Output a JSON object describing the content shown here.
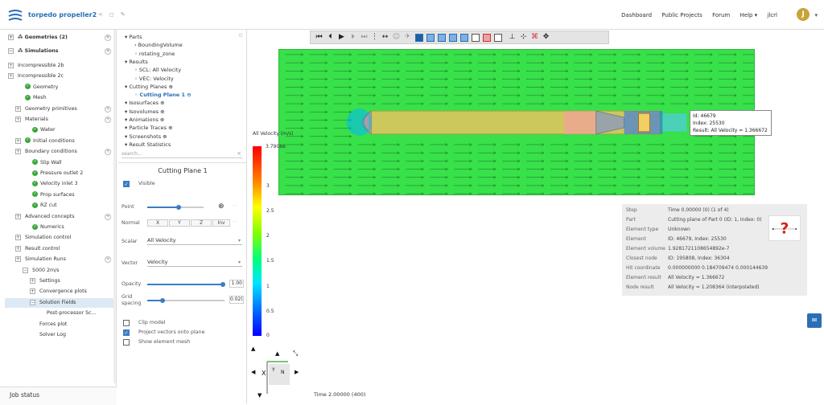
{
  "app": {
    "project_title": "torpedo propeller2",
    "nav": [
      "Dashboard",
      "Public Projects",
      "Forum",
      "Help ▾",
      "jlcrl"
    ],
    "avatar_letter": "J"
  },
  "tree": {
    "geometries": "Geometries (2)",
    "simulations": "Simulations",
    "items": [
      {
        "label": "Incompressible 2b",
        "indent": 0
      },
      {
        "label": "Incompressible 2c",
        "indent": 0
      },
      {
        "label": "Geometry",
        "indent": 1
      },
      {
        "label": "Mesh",
        "indent": 1
      },
      {
        "label": "Geometry primitives",
        "indent": 1
      },
      {
        "label": "Materials",
        "indent": 1
      },
      {
        "label": "Water",
        "indent": 2
      },
      {
        "label": "Initial conditions",
        "indent": 1
      },
      {
        "label": "Boundary conditions",
        "indent": 1
      },
      {
        "label": "Slip Wall",
        "indent": 2
      },
      {
        "label": "Pressure outlet 2",
        "indent": 2
      },
      {
        "label": "Velocity inlet 3",
        "indent": 2
      },
      {
        "label": "Prop surfaces",
        "indent": 2
      },
      {
        "label": "RZ cut",
        "indent": 2
      },
      {
        "label": "Advanced concepts",
        "indent": 1
      },
      {
        "label": "Numerics",
        "indent": 2
      },
      {
        "label": "Simulation control",
        "indent": 1
      },
      {
        "label": "Result control",
        "indent": 1
      },
      {
        "label": "Simulation Runs",
        "indent": 1
      },
      {
        "label": "5000 2m/s",
        "indent": 2
      },
      {
        "label": "Settings",
        "indent": 3
      },
      {
        "label": "Convergence plots",
        "indent": 3
      },
      {
        "label": "Solution Fields",
        "indent": 3
      },
      {
        "label": "Post-processor Sc...",
        "indent": 4
      },
      {
        "label": "Forces plot",
        "indent": 3
      },
      {
        "label": "Solver Log",
        "indent": 3
      }
    ],
    "job_status": "Job status"
  },
  "post_tree": {
    "items": [
      {
        "label": "Parts",
        "level": 0
      },
      {
        "label": "BoundingVolume",
        "level": 1
      },
      {
        "label": "rotating_zone",
        "level": 1
      },
      {
        "label": "Results",
        "level": 0
      },
      {
        "label": "SCL: All Velocity",
        "level": 1
      },
      {
        "label": "VEC: Velocity",
        "level": 1
      },
      {
        "label": "Cutting Planes ⊕",
        "level": 0
      },
      {
        "label": "Cutting Plane 1 ⊖",
        "level": 1
      },
      {
        "label": "Isosurfaces ⊕",
        "level": 0
      },
      {
        "label": "Isovolumes ⊕",
        "level": 0
      },
      {
        "label": "Animations ⊕",
        "level": 0
      },
      {
        "label": "Particle Traces ⊕",
        "level": 0
      },
      {
        "label": "Screenshots ⊕",
        "level": 0
      },
      {
        "label": "Result Statistics",
        "level": 0
      }
    ],
    "search_placeholder": "search..."
  },
  "panel": {
    "title": "Cutting Plane 1",
    "visible_label": "Visible",
    "point_label": "Point",
    "normal_label": "Normal",
    "normal_buttons": [
      "X",
      "Y",
      "Z",
      "Inv"
    ],
    "scalar_label": "Scalar",
    "scalar_value": "All Velocity",
    "vector_label": "Vector",
    "vector_value": "Velocity",
    "opacity_label": "Opacity",
    "opacity_value": "1.00",
    "grid_label": "Grid spacing",
    "grid_value": "0.02(",
    "clip_label": "Clip model",
    "project_label": "Project vectors onto plane",
    "mesh_label": "Show element mesh"
  },
  "legend": {
    "title": "All Velocity (m/s)",
    "max": "3.79088",
    "ticks": [
      "3",
      "2.5",
      "2",
      "1.5",
      "1",
      "0.5",
      "0"
    ]
  },
  "tooltip": {
    "lines": [
      "Id: 46679",
      "Index: 25530",
      "Result: All Velocity = 1.366672"
    ]
  },
  "info": {
    "rows": [
      {
        "k": "Step",
        "v": "Time 0.00000 (0) (1 of 4)"
      },
      {
        "k": "Part",
        "v": "Cutting plane of Part 0 (ID: 1, Index: 0)"
      },
      {
        "k": "Element type",
        "v": "Unknown"
      },
      {
        "k": "Element",
        "v": "ID: 46679, Index: 25530"
      },
      {
        "k": "Element volume",
        "v": "1.9281721108654892e-7"
      },
      {
        "k": "Closest node",
        "v": "ID: 195808, Index: 36304"
      },
      {
        "k": "Hit coordinate",
        "v": "0.000000000 0.184709474 0.000144639"
      },
      {
        "k": "Element result",
        "v": "All Velocity = 1.366672"
      },
      {
        "k": "Node result",
        "v": "All Velocity = 1.208364 (interpolated)"
      }
    ]
  },
  "viewport": {
    "time_label": "Time 2.00000 (400)",
    "triad_x": "X",
    "triad_y": "Y",
    "triad_n": "N"
  }
}
